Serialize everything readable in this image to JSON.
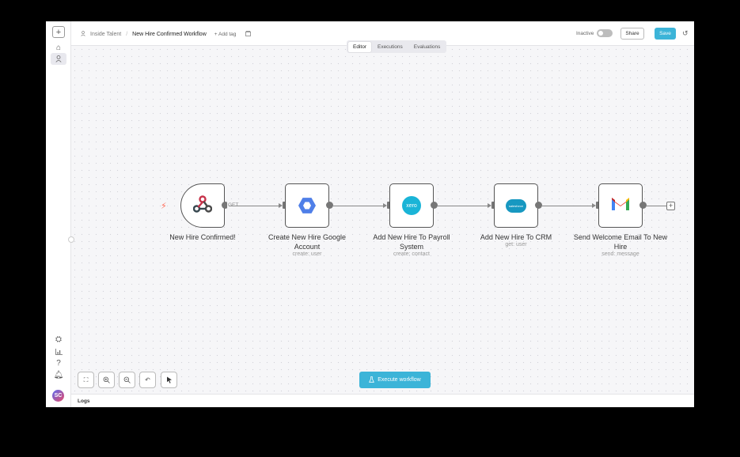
{
  "header": {
    "project": "Inside Talent",
    "separator": "/",
    "workflow_name": "New Hire Confirmed Workflow",
    "add_tag": "+ Add tag",
    "status_label": "Inactive",
    "share_label": "Share",
    "save_label": "Save"
  },
  "tabs": [
    {
      "label": "Editor",
      "active": true
    },
    {
      "label": "Executions",
      "active": false
    },
    {
      "label": "Evaluations",
      "active": false
    }
  ],
  "nodes": [
    {
      "label": "New Hire Confirmed!",
      "sub": "",
      "icon": "webhook-icon"
    },
    {
      "label": "Create New Hire Google Account",
      "sub": "create: user",
      "icon": "google-workspace-icon"
    },
    {
      "label": "Add New Hire To Payroll System",
      "sub": "create: contact",
      "icon": "xero-icon"
    },
    {
      "label": "Add New Hire To CRM",
      "sub": "get: user",
      "icon": "salesforce-icon"
    },
    {
      "label": "Send Welcome Email To New Hire",
      "sub": "send: message",
      "icon": "gmail-icon"
    }
  ],
  "connection_label": "GET",
  "xero_text": "xero",
  "salesforce_text": "salesforce",
  "avatar_initials": "SC",
  "execute_label": "Execute workflow",
  "logs_label": "Logs",
  "colors": {
    "accent": "#3cb4d8",
    "trigger": "#ff6d5a"
  }
}
